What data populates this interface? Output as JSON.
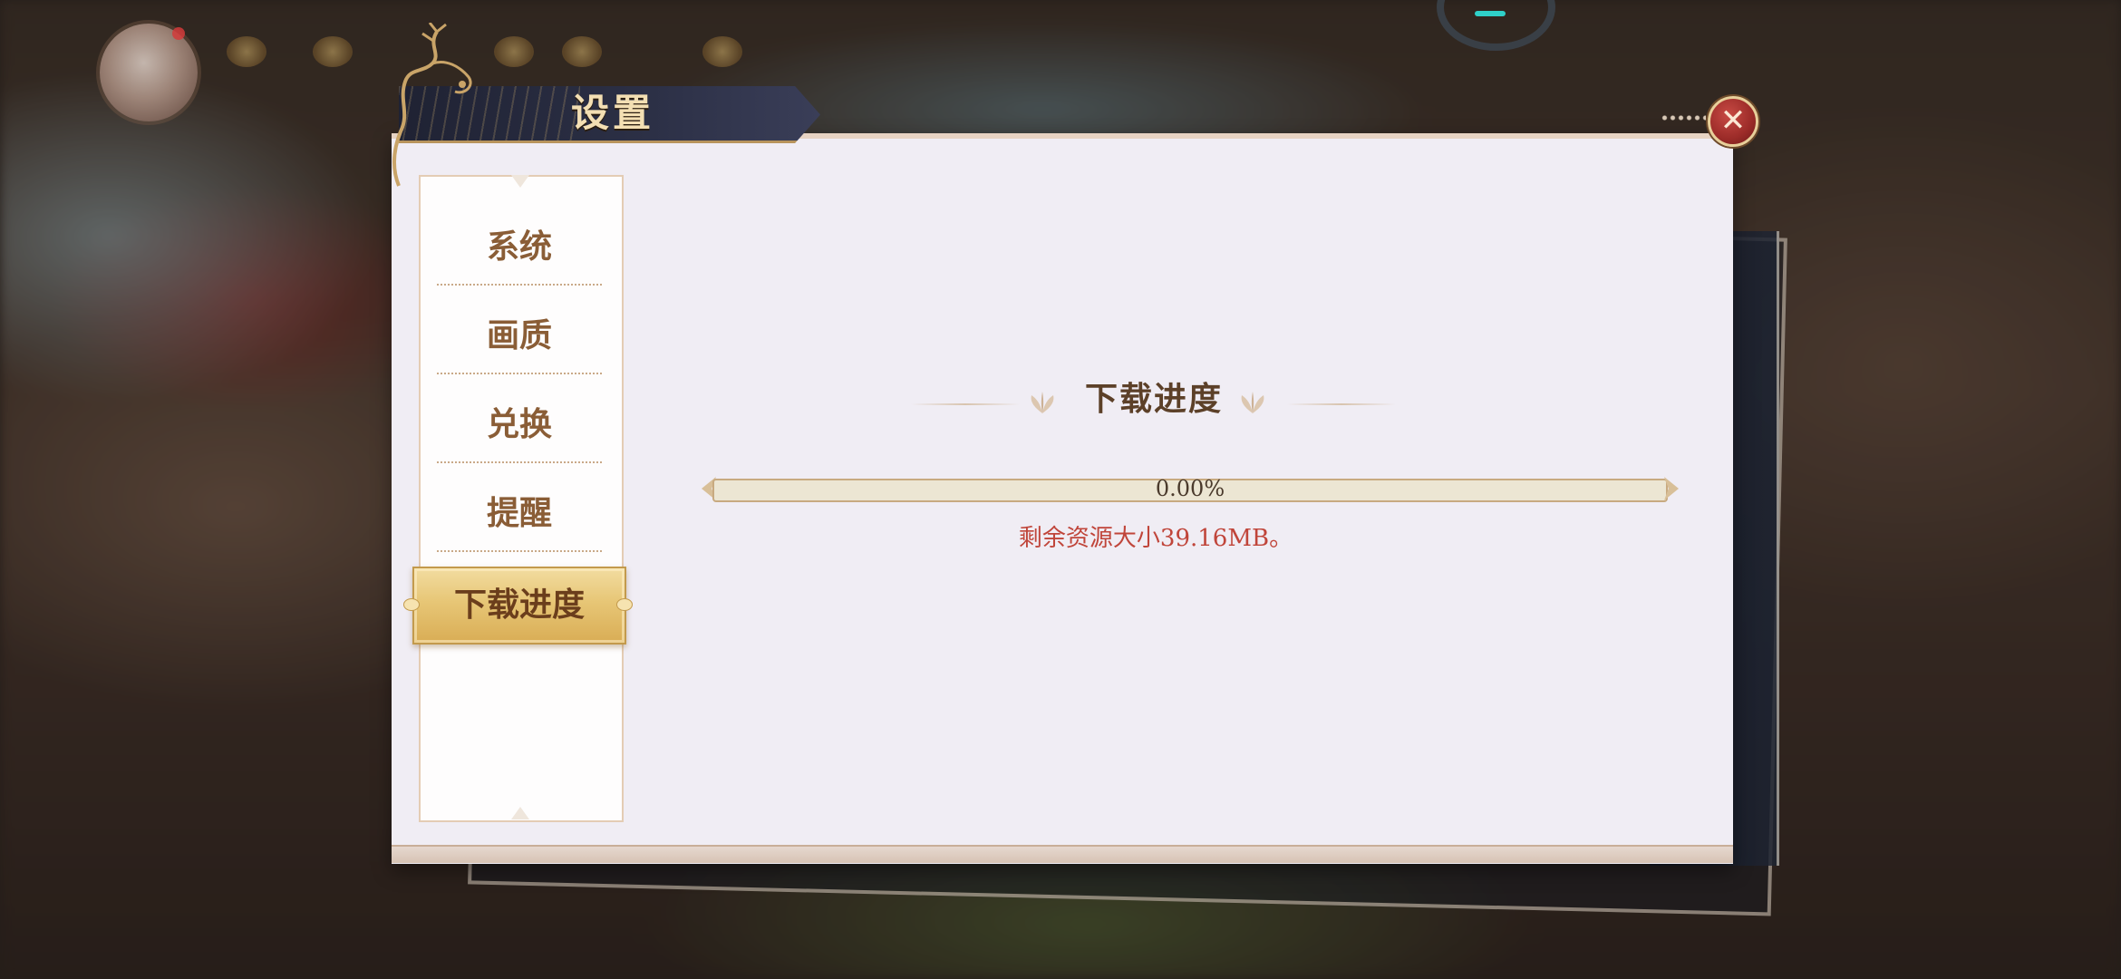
{
  "window": {
    "title": "设置"
  },
  "close_button": {
    "label": "✕",
    "icon": "close-icon"
  },
  "sidebar": {
    "items": [
      {
        "label": "系统",
        "active": false
      },
      {
        "label": "画质",
        "active": false
      },
      {
        "label": "兑换",
        "active": false
      },
      {
        "label": "提醒",
        "active": false
      },
      {
        "label": "下载进度",
        "active": true
      }
    ]
  },
  "main": {
    "section_title": "下载进度",
    "progress": {
      "value_percent": 0.0,
      "label": "0.00%"
    },
    "remaining_text": "剩余资源大小39.16MB。"
  },
  "colors": {
    "accent_gold": "#e7c676",
    "nav_text": "#8a5d36",
    "warning_text": "#c0453a",
    "panel_bg": "#f0edf4",
    "title_banner": "#2c3046",
    "close_red": "#9b2b28"
  }
}
